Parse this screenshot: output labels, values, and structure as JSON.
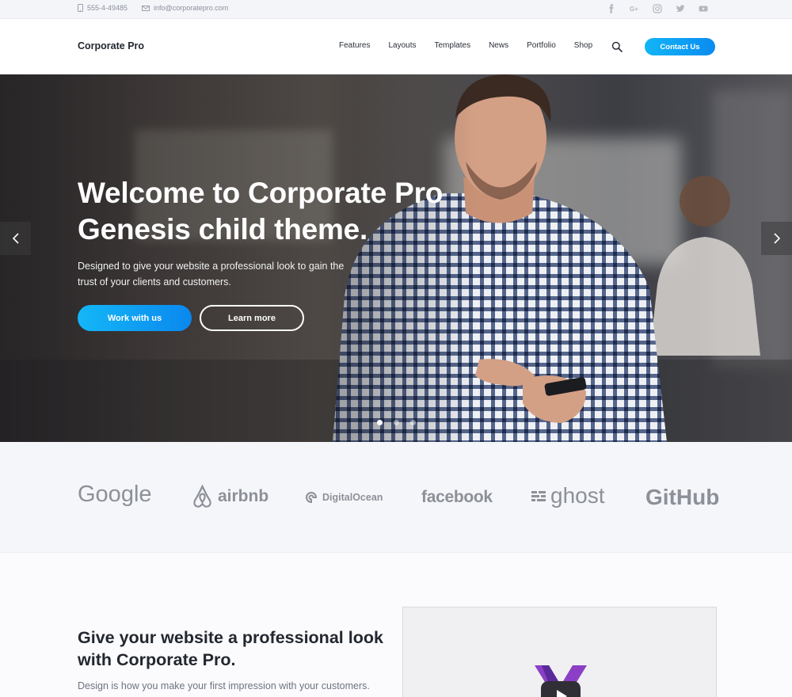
{
  "topbar": {
    "phone": "555-4-49485",
    "email": "info@corporatepro.com",
    "social_icons": [
      "facebook-icon",
      "google-plus-icon",
      "instagram-icon",
      "twitter-icon",
      "youtube-icon"
    ]
  },
  "header": {
    "logo": "Corporate Pro",
    "nav": [
      "Features",
      "Layouts",
      "Templates",
      "News",
      "Portfolio",
      "Shop"
    ],
    "contact_label": "Contact Us"
  },
  "hero": {
    "title_line1": "Welcome to Corporate Pro",
    "title_line2": "Genesis child theme.",
    "subtitle": "Designed to give your website a professional look to gain the trust of your clients and customers.",
    "primary_button": "Work with us",
    "secondary_button": "Learn more",
    "slides_count": 3,
    "active_slide": 1
  },
  "logos": [
    "Google",
    "airbnb",
    "DigitalOcean",
    "facebook",
    "ghost",
    "GitHub"
  ],
  "feature": {
    "title": "Give your website a professional look with Corporate Pro.",
    "text": "Design is how you make your first impression with your customers."
  },
  "colors": {
    "accent": "#0fa6f5",
    "logo_gray": "#8d9098",
    "topbar_bg": "#f4f5f8"
  }
}
